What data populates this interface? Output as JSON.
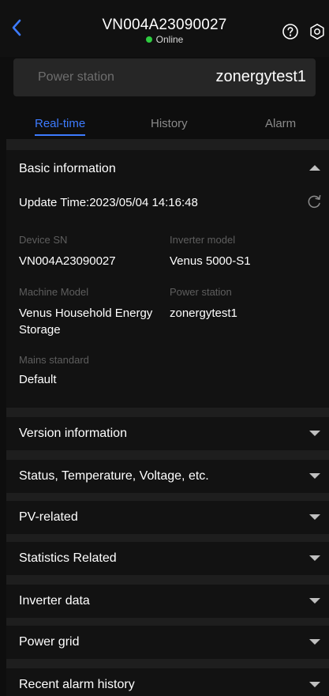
{
  "header": {
    "title": "VN004A23090027",
    "status": "Online",
    "status_color": "#2ecc40",
    "icons": [
      "back-chevron-icon",
      "help-icon",
      "settings-icon"
    ]
  },
  "station_bar": {
    "label": "Power station",
    "value": "zonergytest1"
  },
  "tabs": [
    {
      "label": "Real-time",
      "active": true
    },
    {
      "label": "History",
      "active": false
    },
    {
      "label": "Alarm",
      "active": false
    }
  ],
  "basic_info": {
    "title": "Basic information",
    "update_label": "Update Time:",
    "update_value": "2023/05/04 14:16:48",
    "fields": {
      "device_sn": {
        "label": "Device SN",
        "value": "VN004A23090027"
      },
      "inverter_model": {
        "label": "Inverter model",
        "value": "Venus 5000-S1"
      },
      "machine_model": {
        "label": "Machine Model",
        "value": "Venus Household Energy Storage"
      },
      "power_station": {
        "label": "Power station",
        "value": "zonergytest1"
      },
      "mains_standard": {
        "label": "Mains standard",
        "value": "Default"
      }
    }
  },
  "sections": [
    "Version information",
    "Status, Temperature, Voltage, etc.",
    "PV-related",
    "Statistics Related",
    "Inverter data",
    "Power grid",
    "Recent alarm history"
  ],
  "accent_color": "#3d7bff"
}
